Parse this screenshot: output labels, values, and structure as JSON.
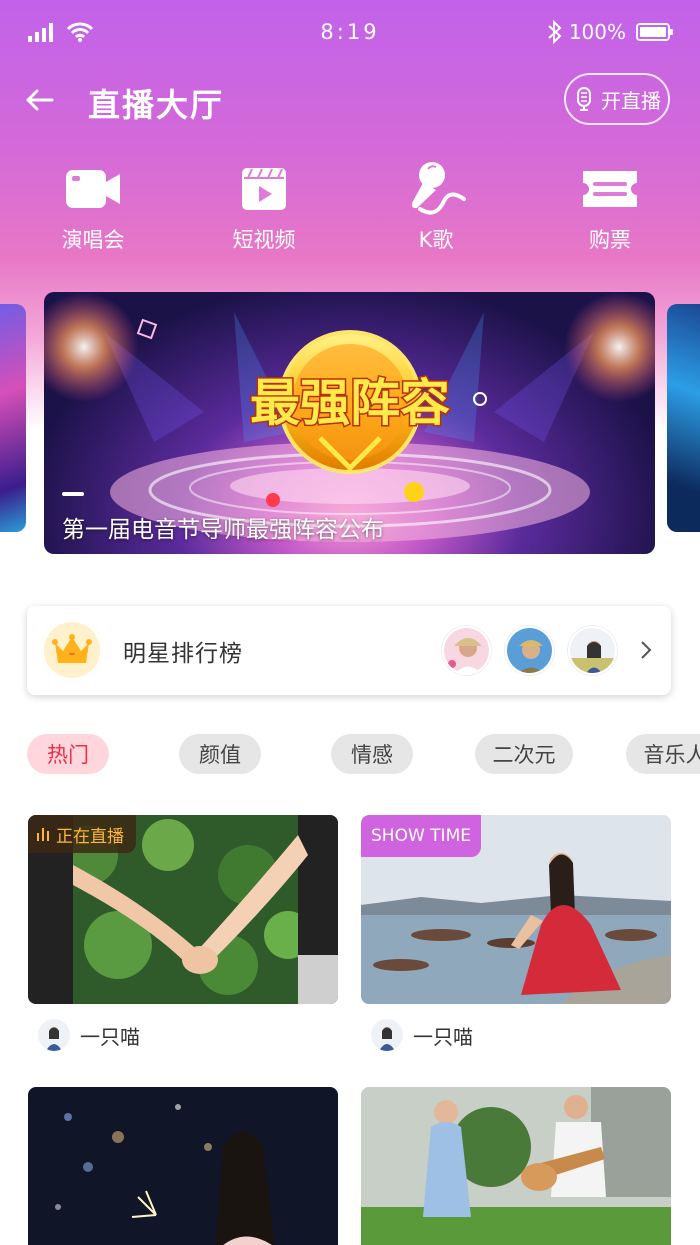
{
  "status": {
    "time": "8:19",
    "battery": "100%",
    "battery_level": 1.0
  },
  "nav": {
    "title": "直播大厅",
    "live_button": "开直播"
  },
  "categories": [
    {
      "label": "演唱会",
      "icon": "video-camera-icon"
    },
    {
      "label": "短视频",
      "icon": "clapperboard-icon"
    },
    {
      "label": "K歌",
      "icon": "microphone-icon"
    },
    {
      "label": "购票",
      "icon": "ticket-icon"
    }
  ],
  "banner": {
    "title": "第一届电音节导师最强阵容公布",
    "logo_text": "最强阵容"
  },
  "ranking": {
    "title": "明星排行榜",
    "icon": "crown-icon"
  },
  "tags": [
    {
      "label": "热门",
      "active": true
    },
    {
      "label": "颜值",
      "active": false
    },
    {
      "label": "情感",
      "active": false
    },
    {
      "label": "二次元",
      "active": false
    },
    {
      "label": "音乐人",
      "active": false
    }
  ],
  "streams": [
    {
      "badge": "正在直播",
      "user": "一只喵"
    },
    {
      "badge": "SHOW TIME",
      "user": "一只喵"
    },
    {
      "badge": "",
      "user": ""
    },
    {
      "badge": "",
      "user": ""
    }
  ],
  "colors": {
    "accent": "#c262ea",
    "tag_active_bg": "#ffd6dc",
    "tag_active_text": "#ee2d47",
    "live_badge": "#ffb43a"
  }
}
